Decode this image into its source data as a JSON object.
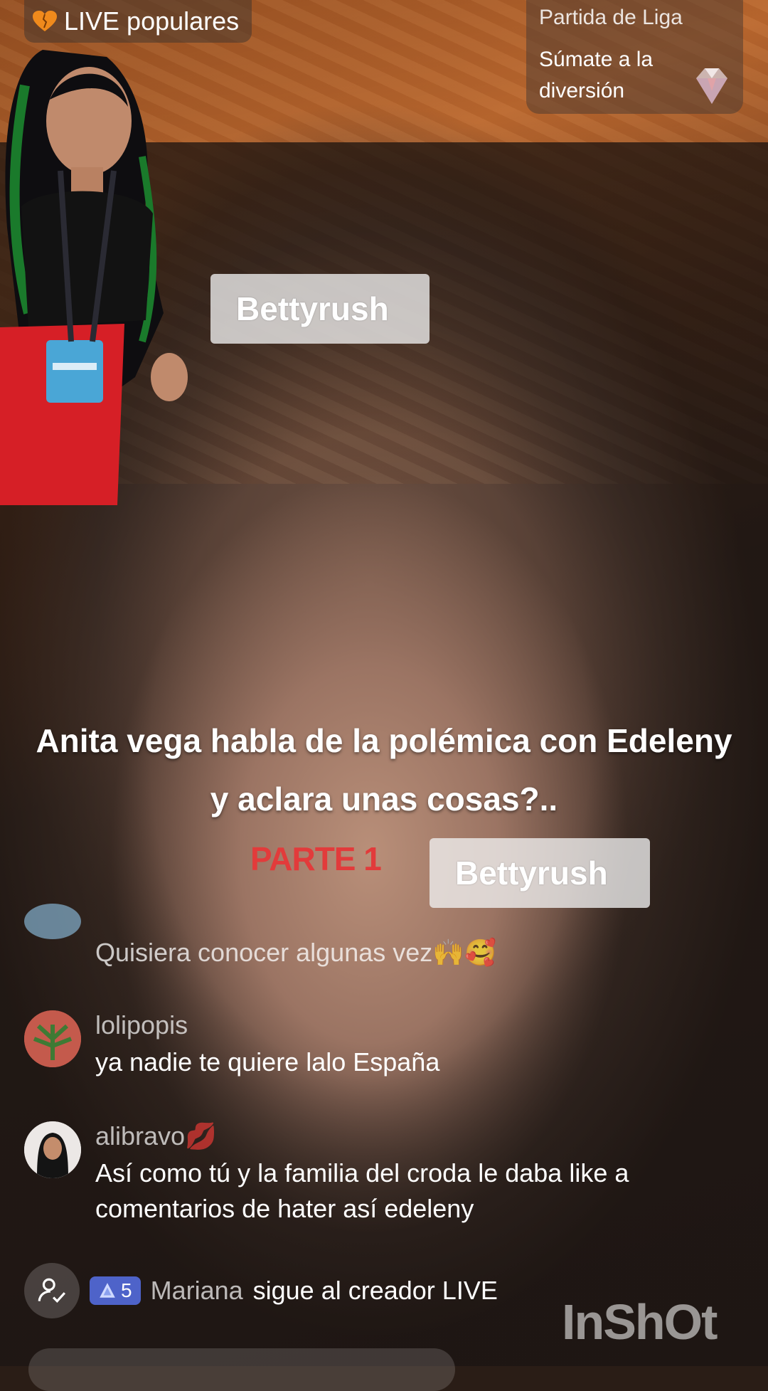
{
  "top": {
    "live_label": "LIVE populares",
    "league_title": "Partida de Liga",
    "league_subtitle": "Súmate a la diversión"
  },
  "watermarks": [
    "Bettyrush",
    "Bettyrush"
  ],
  "headline": "Anita vega habla de la polémica con Edeleny y aclara unas cosas?..",
  "part_label": "PARTE 1",
  "comments": [
    {
      "user": "",
      "text": "Quisiera conocer algunas vez🙌🥰"
    },
    {
      "user": "lolipopis",
      "text": "ya nadie te quiere lalo España"
    },
    {
      "user": "alibravo💋",
      "text": "Así como tú y la familia del croda le daba like a comentarios de hater así edeleny"
    }
  ],
  "follow_event": {
    "level": "5",
    "name": "Mariana",
    "action": "sigue al creador LIVE"
  },
  "brand_watermark": "InShOt",
  "colors": {
    "accent_red": "#e23b3b",
    "badge_blue": "#4e63c9"
  }
}
